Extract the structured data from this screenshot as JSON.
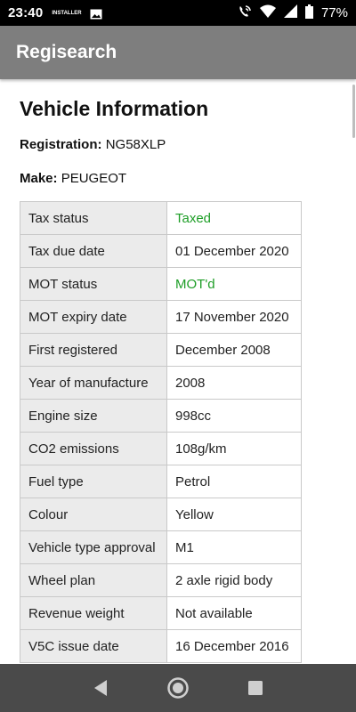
{
  "status_bar": {
    "time": "23:40",
    "notification_label": "INSTALLER",
    "battery_percent": "77%",
    "icons": [
      "image-icon",
      "wifi-call-icon",
      "wifi-icon",
      "signal-icon",
      "battery-icon"
    ]
  },
  "app_bar": {
    "title": "Regisearch"
  },
  "main": {
    "heading": "Vehicle Information",
    "registration_label": "Registration:",
    "registration_value": "NG58XLP",
    "make_label": "Make:",
    "make_value": "PEUGEOT",
    "rows": [
      {
        "label": "Tax status",
        "value": "Taxed"
      },
      {
        "label": "Tax due date",
        "value": "01 December 2020"
      },
      {
        "label": "MOT status",
        "value": "MOT'd"
      },
      {
        "label": "MOT expiry date",
        "value": "17 November 2020"
      },
      {
        "label": "First registered",
        "value": "December 2008"
      },
      {
        "label": "Year of manufacture",
        "value": "2008"
      },
      {
        "label": "Engine size",
        "value": "998cc"
      },
      {
        "label": "CO2 emissions",
        "value": "108g/km"
      },
      {
        "label": "Fuel type",
        "value": "Petrol"
      },
      {
        "label": "Colour",
        "value": "Yellow"
      },
      {
        "label": "Vehicle type approval",
        "value": "M1"
      },
      {
        "label": "Wheel plan",
        "value": "2 axle rigid body"
      },
      {
        "label": "Revenue weight",
        "value": "Not available"
      },
      {
        "label": "V5C issue date",
        "value": "16 December 2016"
      }
    ]
  },
  "colors": {
    "status_ok": "#1e9e27",
    "app_bar": "#7e7e7e",
    "nav_bar": "#4a4a4a"
  },
  "nav_bar": {
    "buttons": [
      "back-icon",
      "home-icon",
      "recents-icon"
    ]
  }
}
